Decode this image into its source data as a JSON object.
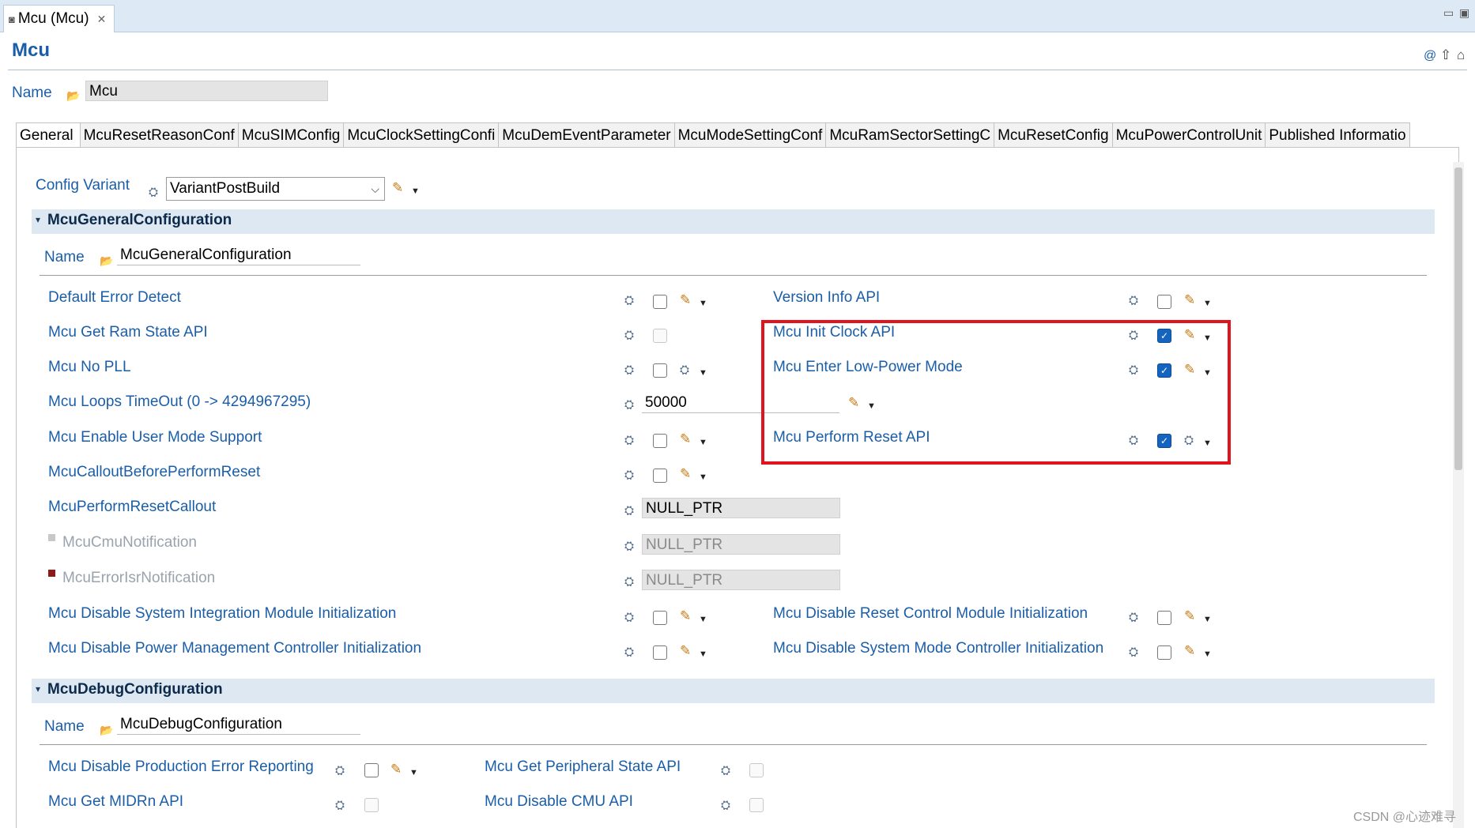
{
  "editor_tab": {
    "title": "Mcu (Mcu)",
    "close": "✕"
  },
  "window_controls": {
    "minimize": "▭",
    "maximize": "▣"
  },
  "title": "Mcu",
  "name_label": "Name",
  "name_value": "Mcu",
  "header_icons": {
    "link": "@",
    "up": "⇧",
    "home": "⌂"
  },
  "tabs": [
    "General",
    "McuResetReasonConf",
    "McuSIMConfig",
    "McuClockSettingConfi",
    "McuDemEventParameter",
    "McuModeSettingConf",
    "McuRamSectorSettingC",
    "McuResetConfig",
    "McuPowerControlUnit",
    "Published Informatio"
  ],
  "config_variant": {
    "label": "Config Variant",
    "value": "VariantPostBuild"
  },
  "general": {
    "section": "McuGeneralConfiguration",
    "name_label": "Name",
    "name_value": "McuGeneralConfiguration",
    "left": [
      {
        "label": "Default Error Detect",
        "kind": "checkbox",
        "checked": false
      },
      {
        "label": "Mcu Get Ram State API",
        "kind": "checkbox-disabled",
        "checked": false
      },
      {
        "label": "Mcu No PLL",
        "kind": "checkbox",
        "checked": false
      },
      {
        "label": "Mcu Loops TimeOut (0 -> 4294967295)",
        "kind": "number",
        "value": "50000"
      },
      {
        "label": "Mcu Enable User Mode Support",
        "kind": "checkbox",
        "checked": false
      },
      {
        "label": "McuCalloutBeforePerformReset",
        "kind": "checkbox",
        "checked": false
      },
      {
        "label": "McuPerformResetCallout",
        "kind": "text",
        "value": "NULL_PTR"
      },
      {
        "label": "McuCmuNotification",
        "kind": "text-disabled",
        "value": "NULL_PTR"
      },
      {
        "label": "McuErrorIsrNotification",
        "kind": "text-disabled",
        "value": "NULL_PTR"
      },
      {
        "label": "Mcu Disable System Integration Module Initialization",
        "kind": "checkbox",
        "checked": false
      },
      {
        "label": "Mcu Disable Power Management Controller Initialization",
        "kind": "checkbox",
        "checked": false
      }
    ],
    "right": [
      {
        "label": "Version Info API",
        "checked": false
      },
      {
        "label": "Mcu Init Clock API",
        "checked": true
      },
      {
        "label": "Mcu Enter Low-Power Mode",
        "checked": true
      },
      {
        "label": "Mcu Perform Reset API",
        "checked": true
      },
      {
        "label": "Mcu Disable Reset Control Module Initialization",
        "checked": false
      },
      {
        "label": "Mcu Disable System Mode Controller Initialization",
        "checked": false
      }
    ]
  },
  "debug": {
    "section": "McuDebugConfiguration",
    "name_label": "Name",
    "name_value": "McuDebugConfiguration",
    "items": [
      {
        "label": "Mcu Disable Production Error Reporting",
        "checked": false
      },
      {
        "label": "Mcu Get MIDRn API",
        "checked": false
      },
      {
        "label": "Mcu Get Peripheral State API",
        "checked": false
      },
      {
        "label": "Mcu Disable CMU API",
        "checked": false
      }
    ]
  },
  "icons": {
    "param": "⛭",
    "pen": "✎",
    "drop": "▼",
    "folder": "📂",
    "check": "✓",
    "collapse": "▾"
  },
  "watermark": "CSDN @心迹难寻",
  "colors": {
    "label": "#1b5ea8",
    "section_bg": "#dde8f3",
    "highlight_box": "#e0141e",
    "checkbox_on": "#1565c0"
  }
}
